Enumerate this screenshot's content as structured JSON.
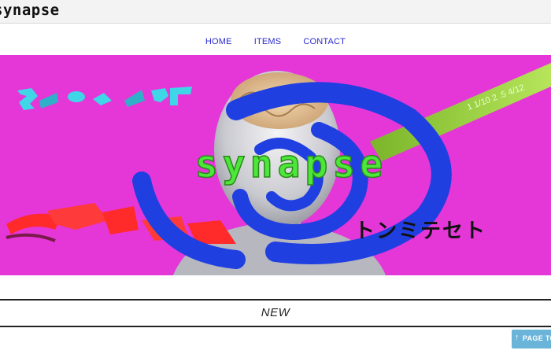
{
  "header": {
    "logo_text": "synapse"
  },
  "nav": {
    "items": [
      {
        "label": "HOME"
      },
      {
        "label": "ITEMS"
      },
      {
        "label": "CONTACT"
      }
    ]
  },
  "hero": {
    "title": "synapse",
    "katakana_text": "トンミテセト",
    "fraction_text": "1 1/10 2 .5 4/12",
    "colors": {
      "background": "#e536d8",
      "spiral": "#1f3fe0",
      "title": "#4de63a",
      "ribbon": "#9bd13a",
      "red_shapes": "#ff2a2a",
      "cyan_shapes": "#3fd6e8"
    }
  },
  "section": {
    "title": "NEW"
  },
  "page_top": {
    "label": "PAGE TOP",
    "arrow_icon": "arrow-up-icon"
  }
}
